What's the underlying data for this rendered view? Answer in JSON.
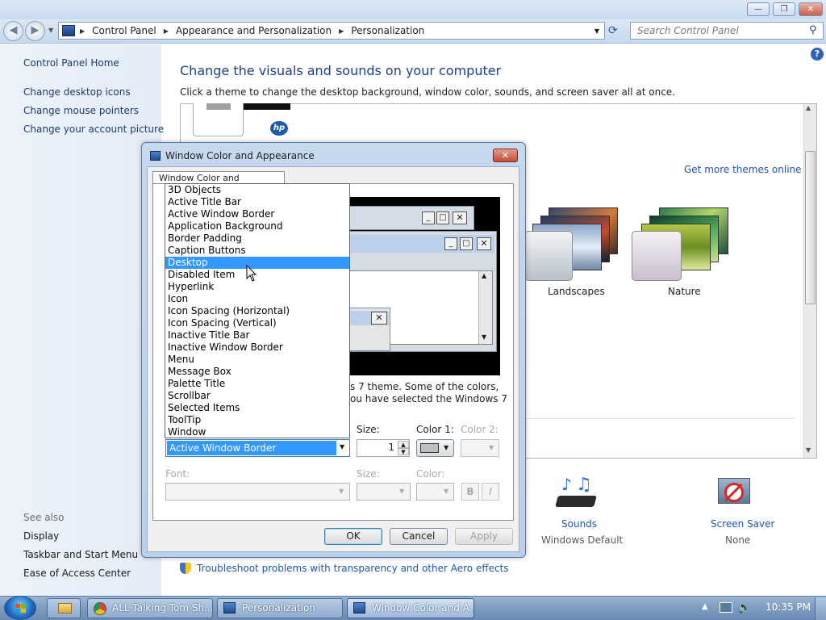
{
  "window": {
    "min": "—",
    "max": "❐",
    "close": "✕"
  },
  "nav": {
    "breadcrumb": [
      "Control Panel",
      "Appearance and Personalization",
      "Personalization"
    ],
    "search_placeholder": "Search Control Panel"
  },
  "left": {
    "home": "Control Panel Home",
    "links": [
      "Change desktop icons",
      "Change mouse pointers",
      "Change your account picture"
    ],
    "see_also": "See also",
    "see_also_links": [
      "Display",
      "Taskbar and Start Menu",
      "Ease of Access Center"
    ]
  },
  "main": {
    "title": "Change the visuals and sounds on your computer",
    "subtitle": "Click a theme to change the desktop background, window color, sounds, and screen saver all at once.",
    "more_themes": "Get more themes online",
    "themes": [
      "Landscapes",
      "Nature"
    ],
    "sounds_label": "Sounds",
    "sounds_value": "Windows Default",
    "screensaver_label": "Screen Saver",
    "screensaver_value": "None",
    "troubleshoot": "Troubleshoot problems with transparency and other Aero effects"
  },
  "dialog": {
    "title": "Window Color and Appearance",
    "tab": "Window Color and Appearance",
    "behind_text_1": "s 7 theme.  Some of the colors,",
    "behind_text_2": "ou have selected the Windows 7",
    "item_items": [
      "3D Objects",
      "Active Title Bar",
      "Active Window Border",
      "Application Background",
      "Border Padding",
      "Caption Buttons",
      "Desktop",
      "Disabled Item",
      "Hyperlink",
      "Icon",
      "Icon Spacing (Horizontal)",
      "Icon Spacing (Vertical)",
      "Inactive Title Bar",
      "Inactive Window Border",
      "Menu",
      "Message Box",
      "Palette Title",
      "Scrollbar",
      "Selected Items",
      "ToolTip",
      "Window"
    ],
    "selected_item": "Desktop",
    "item_value": "Active Window Border",
    "size_label": "Size:",
    "size_value": "1",
    "color1_label": "Color 1:",
    "color2_label": "Color 2:",
    "font_label": "Font:",
    "font_size_label": "Size:",
    "font_color_label": "Color:",
    "bold": "B",
    "italic": "I",
    "ok": "OK",
    "cancel": "Cancel",
    "apply": "Apply"
  },
  "taskbar": {
    "items": [
      "ALL Talking Tom Sh...",
      "Personalization",
      "Window Color and A..."
    ],
    "time": "10:35 PM"
  }
}
